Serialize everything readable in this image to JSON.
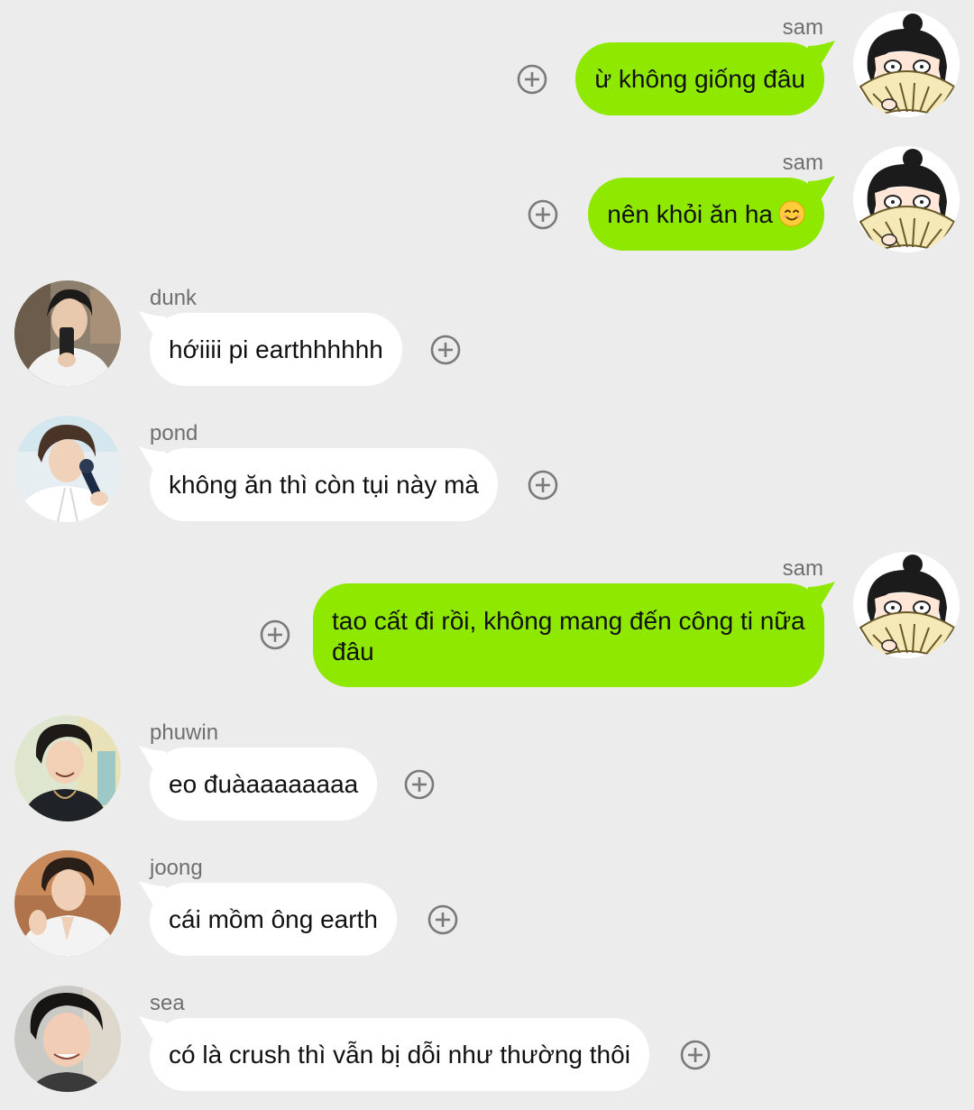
{
  "messages": [
    {
      "sender": "sam",
      "text": "ừ không giống đâu",
      "direction": "out",
      "avatar_icon": "anime-fan-avatar-icon"
    },
    {
      "sender": "sam",
      "text": "nên khỏi ăn ha",
      "emoji": "smiling-face-emoji-icon",
      "direction": "out",
      "avatar_icon": "anime-fan-avatar-icon"
    },
    {
      "sender": "dunk",
      "text": "hớiiii pi earthhhhhh",
      "direction": "in",
      "avatar_icon": "profile-photo-avatar-icon"
    },
    {
      "sender": "pond",
      "text": "không ăn thì còn tụi này mà",
      "direction": "in",
      "avatar_icon": "profile-photo-avatar-icon"
    },
    {
      "sender": "sam",
      "text": "tao cất đi rồi, không mang đến công ti nữa đâu",
      "direction": "out",
      "avatar_icon": "anime-fan-avatar-icon"
    },
    {
      "sender": "phuwin",
      "text": "eo đuàaaaaaaaa",
      "direction": "in",
      "avatar_icon": "profile-photo-avatar-icon"
    },
    {
      "sender": "joong",
      "text": "cái mồm ông earth",
      "direction": "in",
      "avatar_icon": "profile-photo-avatar-icon"
    },
    {
      "sender": "sea",
      "text": "có là crush thì vẫn bị dỗi như thường thôi",
      "direction": "in",
      "avatar_icon": "profile-photo-avatar-icon"
    }
  ],
  "colors": {
    "background": "#ececec",
    "outgoing_bubble": "#8ee800",
    "incoming_bubble": "#ffffff",
    "sender_name": "#6f6f6f",
    "react_icon": "#7a7a7a"
  },
  "icons": {
    "react": "add-reaction-icon"
  }
}
